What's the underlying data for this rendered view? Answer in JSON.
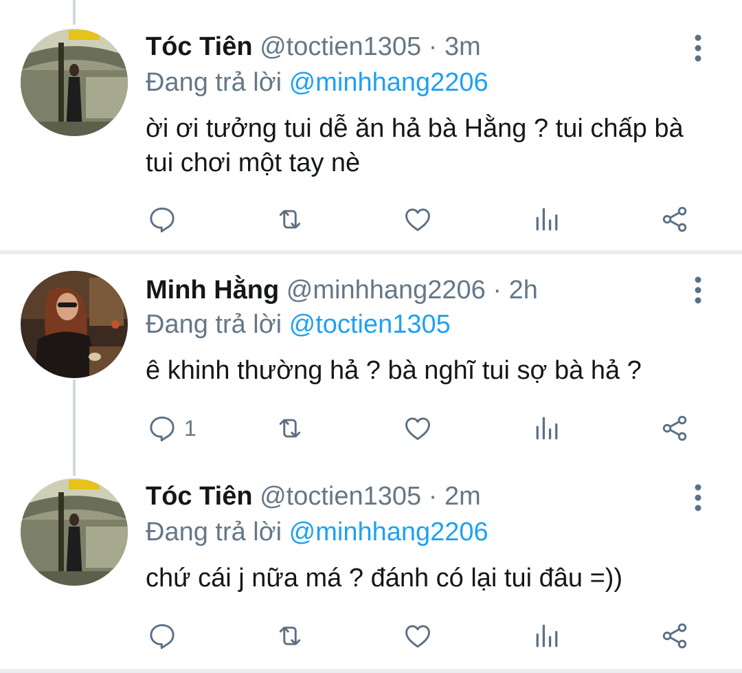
{
  "tweets": [
    {
      "name": "Tóc Tiên",
      "handle": "@toctien1305",
      "dot": "·",
      "time": "3m",
      "reply_prefix": "Đang trả lời",
      "reply_to": "@minhhang2206",
      "text": "ời ơi tưởng tui dễ ăn hả bà Hằng ? tui chấp bà tui chơi một tay nè",
      "reply_count": ""
    },
    {
      "name": "Minh Hằng",
      "handle": "@minhhang2206",
      "dot": "·",
      "time": "2h",
      "reply_prefix": "Đang trả lời",
      "reply_to": "@toctien1305",
      "text": "ê khinh thường hả ? bà nghĩ tui sợ bà hả ?",
      "reply_count": "1"
    },
    {
      "name": "Tóc Tiên",
      "handle": "@toctien1305",
      "dot": "·",
      "time": "2m",
      "reply_prefix": "Đang trả lời",
      "reply_to": "@minhhang2206",
      "text": "chứ cái j nữa má ? đánh có lại tui đâu =))",
      "reply_count": ""
    }
  ],
  "colors": {
    "accent": "#1da1f2",
    "secondary_text": "#657786",
    "icon": "#5b7083"
  },
  "icons": [
    "more-vertical-icon",
    "reply-icon",
    "retweet-icon",
    "like-icon",
    "analytics-icon",
    "share-icon"
  ]
}
